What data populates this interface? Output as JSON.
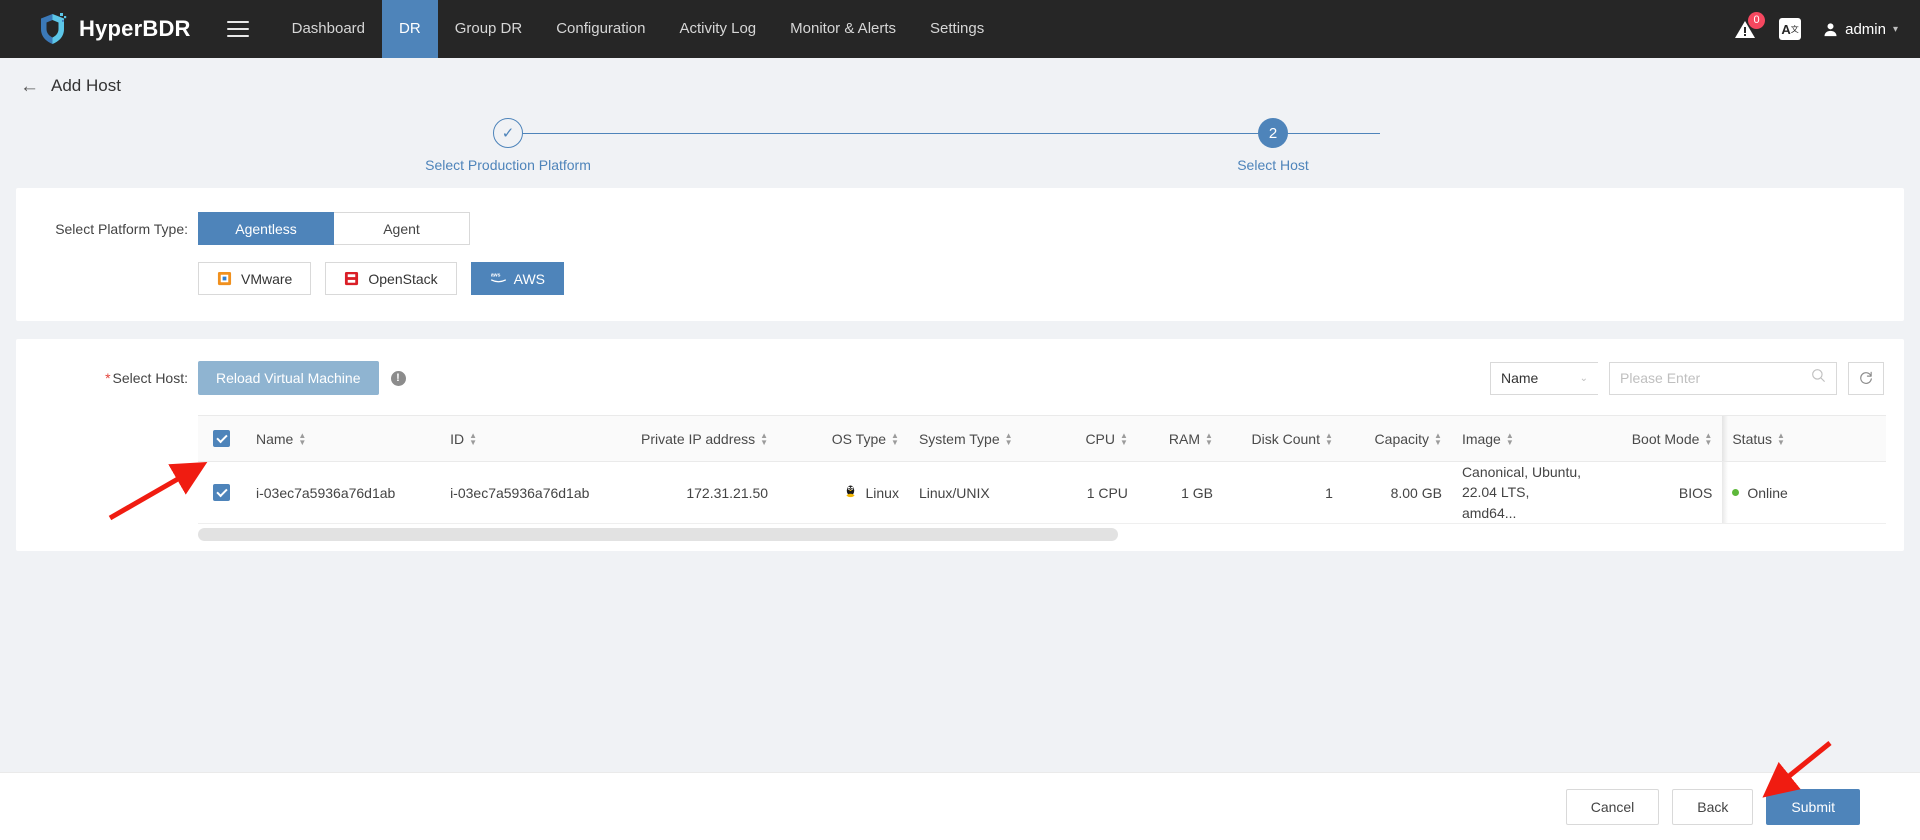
{
  "header": {
    "brand": "HyperBDR",
    "menu_icon": "hamburger-icon",
    "nav": [
      {
        "label": "Dashboard",
        "active": false
      },
      {
        "label": "DR",
        "active": true
      },
      {
        "label": "Group DR",
        "active": false
      },
      {
        "label": "Configuration",
        "active": false
      },
      {
        "label": "Activity Log",
        "active": false
      },
      {
        "label": "Monitor & Alerts",
        "active": false
      },
      {
        "label": "Settings",
        "active": false
      }
    ],
    "alert_badge": "0",
    "lang_label": "A",
    "lang_sup": "文",
    "user": "admin",
    "accent": "#4e84ba",
    "bg": "#262626"
  },
  "page": {
    "back_label": "←",
    "title": "Add Host"
  },
  "stepper": {
    "steps": [
      {
        "marker": "✓",
        "label": "Select Production Platform",
        "state": "done"
      },
      {
        "marker": "2",
        "label": "Select Host",
        "state": "current"
      }
    ]
  },
  "platform": {
    "label": "Select Platform Type:",
    "types": [
      {
        "label": "Agentless",
        "selected": true
      },
      {
        "label": "Agent",
        "selected": false
      }
    ],
    "platforms": [
      {
        "label": "VMware",
        "icon": "vmware-icon",
        "selected": false
      },
      {
        "label": "OpenStack",
        "icon": "openstack-icon",
        "selected": false
      },
      {
        "label": "AWS",
        "icon": "aws-icon",
        "selected": true
      }
    ]
  },
  "host": {
    "label": "Select Host:",
    "required_mark": "*",
    "reload_button": "Reload Virtual Machine",
    "info_icon": "info-icon",
    "search": {
      "field": "Name",
      "placeholder": "Please Enter",
      "value": "",
      "search_icon": "search-icon",
      "refresh_icon": "refresh-icon"
    },
    "table": {
      "header_checkbox_checked": true,
      "columns": [
        {
          "label": "Name",
          "sortable": true,
          "align": "lft"
        },
        {
          "label": "ID",
          "sortable": true,
          "align": "lft"
        },
        {
          "label": "Private IP address",
          "sortable": true,
          "align": "num"
        },
        {
          "label": "OS Type",
          "sortable": true,
          "align": "num"
        },
        {
          "label": "System Type",
          "sortable": true,
          "align": "lft"
        },
        {
          "label": "CPU",
          "sortable": true,
          "align": "num"
        },
        {
          "label": "RAM",
          "sortable": true,
          "align": "num"
        },
        {
          "label": "Disk Count",
          "sortable": true,
          "align": "num"
        },
        {
          "label": "Capacity",
          "sortable": true,
          "align": "num"
        },
        {
          "label": "Image",
          "sortable": true,
          "align": "lft"
        },
        {
          "label": "Boot Mode",
          "sortable": true,
          "align": "num"
        },
        {
          "label": "Status",
          "sortable": true,
          "align": "lft"
        }
      ],
      "rows": [
        {
          "checked": true,
          "name": "i-03ec7a5936a76d1ab",
          "id": "i-03ec7a5936a76d1ab",
          "private_ip": "172.31.21.50",
          "os_type": "Linux",
          "os_icon": "linux-penguin-icon",
          "system_type": "Linux/UNIX",
          "cpu": "1 CPU",
          "ram": "1 GB",
          "disk_count": "1",
          "capacity": "8.00 GB",
          "image": "Canonical, Ubuntu, 22.04 LTS, amd64...",
          "boot_mode": "BIOS",
          "status": "Online",
          "status_color": "#5db83a"
        }
      ]
    }
  },
  "footer": {
    "cancel": "Cancel",
    "back": "Back",
    "submit": "Submit"
  },
  "annotations": {
    "arrow_color": "#f01c11",
    "arrow_checkbox": "arrow-pointing-to-row-checkbox",
    "arrow_submit": "arrow-pointing-to-submit-button"
  }
}
